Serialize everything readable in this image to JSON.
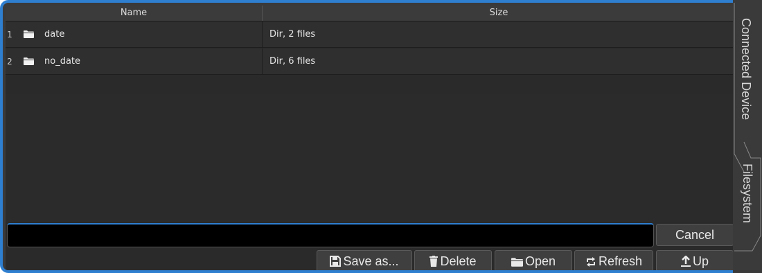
{
  "table": {
    "columns": [
      "Name",
      "Size"
    ],
    "rows": [
      {
        "num": "1",
        "name": "date",
        "size": "Dir, 2 files",
        "icon": "folder-icon"
      },
      {
        "num": "2",
        "name": "no_date",
        "size": "Dir, 6 files",
        "icon": "folder-icon"
      }
    ]
  },
  "filename_input": {
    "value": ""
  },
  "buttons": {
    "cancel": "Cancel",
    "save_as": "Save as...",
    "delete": "Delete",
    "open": "Open",
    "refresh": "Refresh",
    "up": "Up"
  },
  "side_tabs": {
    "connected_device": "Connected Device",
    "filesystem": "Filesystem"
  },
  "colors": {
    "accent": "#2f7fd0",
    "background": "#2a2a2a",
    "text": "#e6e6e6"
  }
}
